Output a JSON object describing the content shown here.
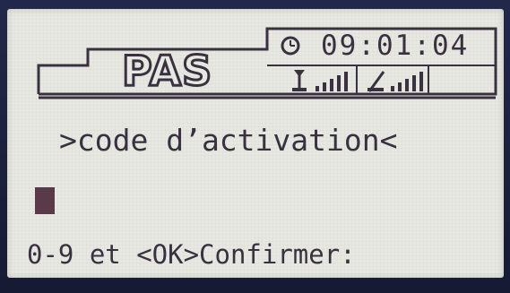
{
  "header": {
    "logo": "PAS",
    "time": "09:01:04",
    "icons": [
      "clock-icon",
      "antenna-signal-icon",
      "network-signal-icon"
    ]
  },
  "main": {
    "prompt": ">code d’activation<",
    "input_value": ""
  },
  "footer": {
    "hint": "0-9 et <OK>Confirmer:"
  },
  "colors": {
    "lcd_background": "#e6e8e1",
    "lcd_foreground": "#3a3140",
    "bezel": "#1a1f3a"
  }
}
